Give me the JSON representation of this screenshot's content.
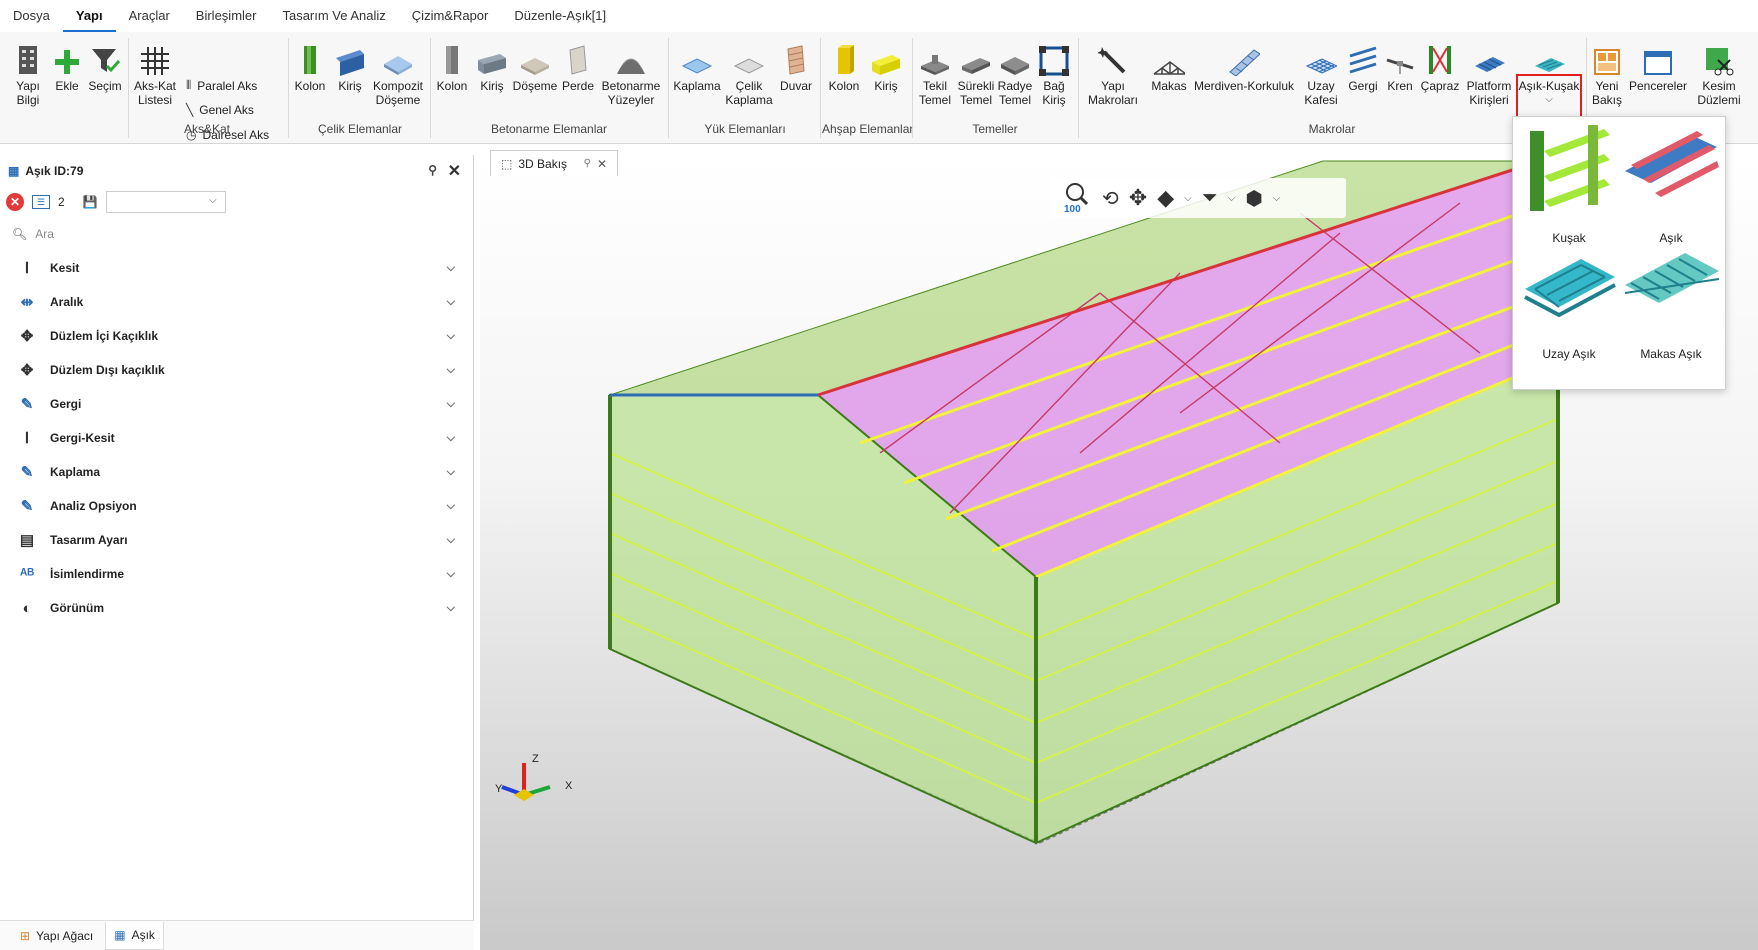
{
  "menu": [
    "Dosya",
    "Yapı",
    "Araçlar",
    "Birleşimler",
    "Tasarım Ve Analiz",
    "Çizim&Rapor",
    "Düzenle-Aşık[1]"
  ],
  "ribbon": {
    "yapi_bilgi": "Yapı\nBilgi",
    "ekle": "Ekle",
    "secim": "Seçim",
    "aks_kat_listesi": "Aks-Kat\nListesi",
    "paralel_aks": "Paralel Aks",
    "genel_aks": "Genel Aks",
    "dairesel_aks": "Dairesel Aks",
    "grp_akskat": "Aks&Kat",
    "celik_kolon": "Kolon",
    "celik_kiris": "Kiriş",
    "kompozit_doseme": "Kompozit\nDöşeme",
    "grp_celik": "Çelik Elemanlar",
    "bet_kolon": "Kolon",
    "bet_kiris": "Kiriş",
    "bet_doseme": "Döşeme",
    "bet_perde": "Perde",
    "bet_yuzey": "Betonarme\nYüzeyler",
    "grp_beton": "Betonarme Elemanlar",
    "kaplama": "Kaplama",
    "celik_kaplama": "Çelik\nKaplama",
    "duvar": "Duvar",
    "grp_yuk": "Yük Elemanları",
    "ahsap_kolon": "Kolon",
    "ahsap_kiris": "Kiriş",
    "grp_ahsap": "Ahşap Elemanlar",
    "tekil_temel": "Tekil\nTemel",
    "surekli_temel": "Sürekli\nTemel",
    "radye_temel": "Radye\nTemel",
    "bag_kiris": "Bağ\nKiriş",
    "grp_temel": "Temeller",
    "yapi_makrolar": "Yapı\nMakroları",
    "makas": "Makas",
    "merdiven": "Merdiven-Korkuluk",
    "uzay_kafes": "Uzay\nKafesi",
    "gergi": "Gergi",
    "kren": "Kren",
    "capraz": "Çapraz",
    "platform": "Platform\nKirişleri",
    "asik_kusak": "Aşık-Kuşak",
    "grp_makro": "Makrolar",
    "yeni_bakis": "Yeni\nBakış",
    "pencereler": "Pencereler",
    "kesim_duzlemi": "Kesim\nDüzlemi"
  },
  "panel": {
    "title": "Aşık ID:79",
    "count": "2",
    "search_placeholder": "Ara",
    "sections": [
      "Kesit",
      "Aralık",
      "Düzlem İçi Kaçıklık",
      "Düzlem Dışı kaçıklık",
      "Gergi",
      "Gergi-Kesit",
      "Kaplama",
      "Analiz Opsiyon",
      "Tasarım Ayarı",
      "İsimlendirme",
      "Görünüm"
    ],
    "tabs": [
      "Yapı Ağacı",
      "Aşık"
    ]
  },
  "view": {
    "tab_label": "3D Bakış",
    "zoom": "100",
    "axis_x": "X",
    "axis_y": "Y",
    "axis_z": "Z"
  },
  "dropdown": {
    "items": [
      "Kuşak",
      "Aşık",
      "Uzay Aşık",
      "Makas Aşık"
    ]
  },
  "colors": {
    "accent": "#1a6fd0",
    "highlight": "#e02020",
    "roof_purple": "#d98ce6",
    "wall_green": "#b5e08a",
    "purlin_yellow": "#f2f23a"
  }
}
